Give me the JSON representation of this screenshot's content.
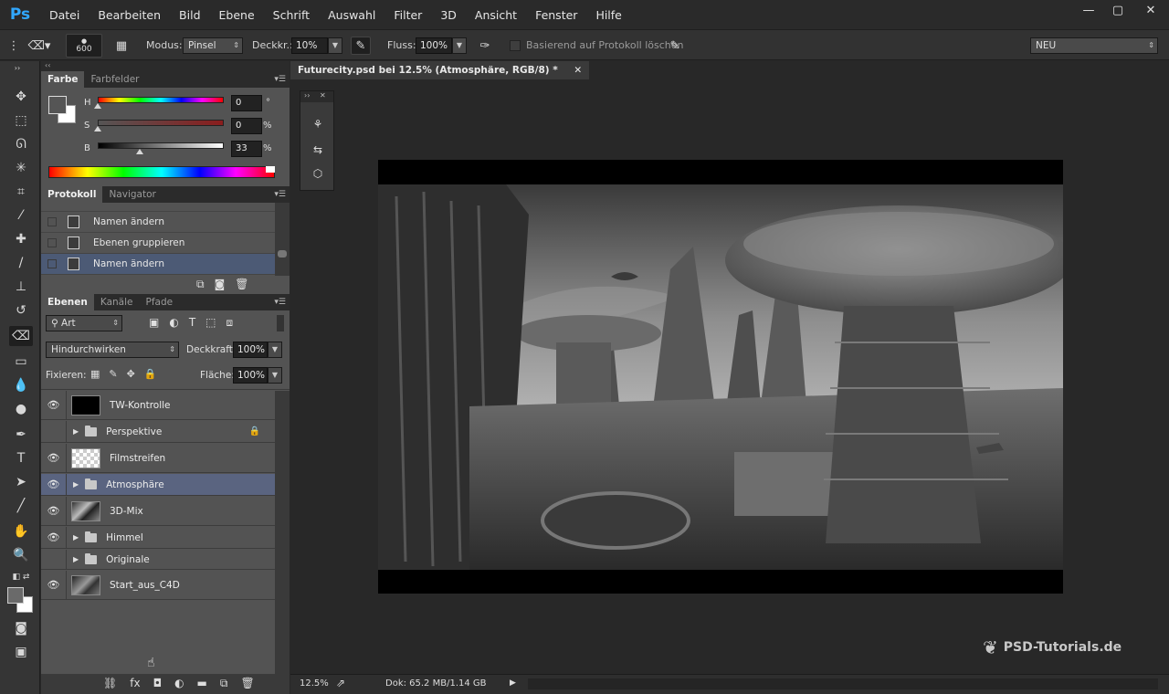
{
  "app": {
    "logo": "Ps",
    "accent": "#31a8ff"
  },
  "menu": [
    "Datei",
    "Bearbeiten",
    "Bild",
    "Ebene",
    "Schrift",
    "Auswahl",
    "Filter",
    "3D",
    "Ansicht",
    "Fenster",
    "Hilfe"
  ],
  "window_controls": {
    "minimize": "—",
    "maximize": "▢",
    "close": "✕"
  },
  "options": {
    "brush_size": "600",
    "mode_label": "Modus:",
    "mode_value": "Pinsel",
    "opacity_label": "Deckkr.:",
    "opacity_value": "10%",
    "flow_label": "Fluss:",
    "flow_value": "100%",
    "history_label": "Basierend auf Protokoll löschen",
    "workspace": "NEU"
  },
  "color_panel": {
    "tabs": [
      "Farbe",
      "Farbfelder"
    ],
    "h_label": "H",
    "h_value": "0",
    "h_unit": "°",
    "s_label": "S",
    "s_value": "0",
    "s_unit": "%",
    "b_label": "B",
    "b_value": "33",
    "b_unit": "%",
    "b_fraction": 0.33
  },
  "history_panel": {
    "tabs": [
      "Protokoll",
      "Navigator"
    ],
    "items": [
      {
        "label": "Namen ändern",
        "selected": false
      },
      {
        "label": "Ebenen gruppieren",
        "selected": false
      },
      {
        "label": "Namen ändern",
        "selected": true
      }
    ]
  },
  "layers_panel": {
    "tabs": [
      "Ebenen",
      "Kanäle",
      "Pfade"
    ],
    "filter_kind": "Art",
    "blend_mode": "Hindurchwirken",
    "opacity_label": "Deckkraft:",
    "opacity_value": "100%",
    "lock_label": "Fixieren:",
    "fill_label": "Fläche:",
    "fill_value": "100%",
    "layers": [
      {
        "name": "TW-Kontrolle",
        "type": "layer",
        "thumb": "black",
        "visible": true
      },
      {
        "name": "Perspektive",
        "type": "group",
        "visible": false,
        "locked": true
      },
      {
        "name": "Filmstreifen",
        "type": "layer",
        "thumb": "transparent",
        "visible": true
      },
      {
        "name": "Atmosphäre",
        "type": "group",
        "visible": true,
        "selected": true
      },
      {
        "name": "3D-Mix",
        "type": "layer",
        "thumb": "image",
        "visible": true
      },
      {
        "name": "Himmel",
        "type": "group",
        "visible": true
      },
      {
        "name": "Originale",
        "type": "group",
        "visible": false
      },
      {
        "name": "Start_aus_C4D",
        "type": "layer",
        "thumb": "image",
        "visible": true
      }
    ]
  },
  "document": {
    "tab_title": "Futurecity.psd bei 12.5% (Atmosphäre, RGB/8) *",
    "zoom": "12.5%",
    "doc_info": "Dok: 65.2 MB/1.14 GB"
  },
  "watermark": "PSD-Tutorials.de"
}
